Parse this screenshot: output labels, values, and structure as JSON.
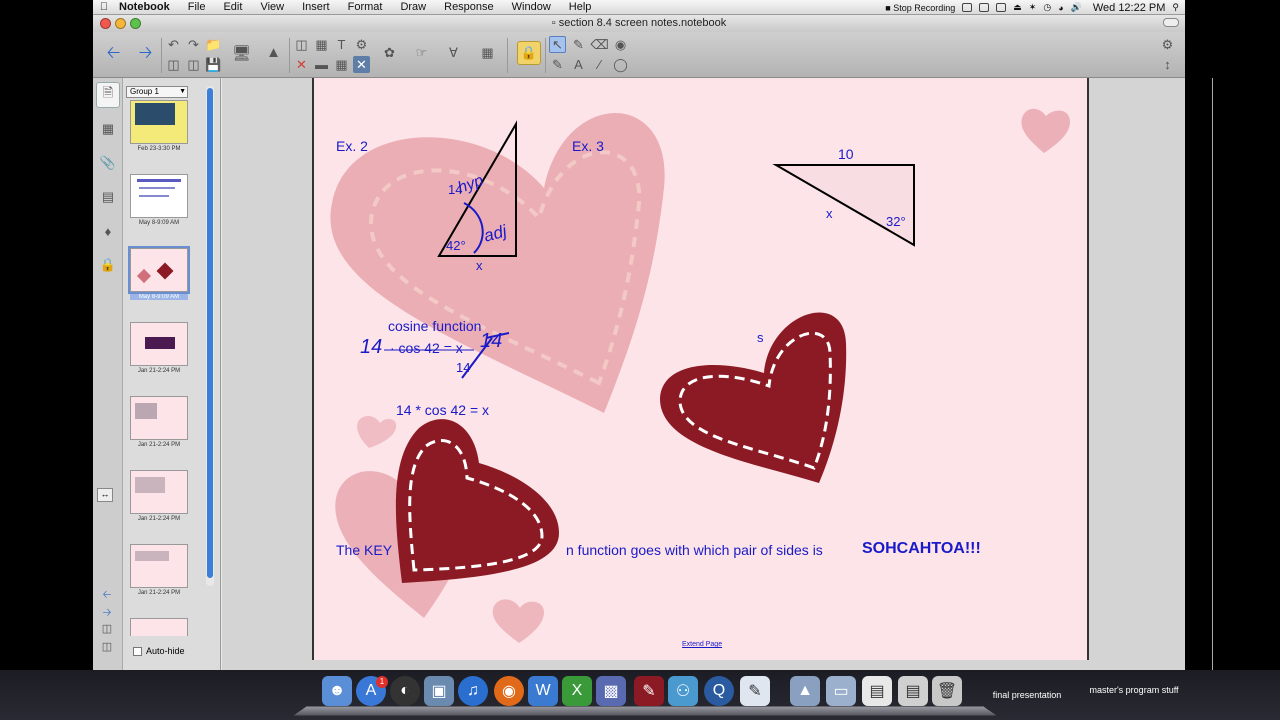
{
  "menubar": {
    "app": "Notebook",
    "items": [
      "File",
      "Edit",
      "View",
      "Insert",
      "Format",
      "Draw",
      "Response",
      "Window",
      "Help"
    ],
    "recording": "Stop Recording",
    "clock": "Wed 12:22 PM"
  },
  "window": {
    "title": "section 8.4 screen notes.notebook"
  },
  "toolbar": {
    "icons": [
      "back-arrow",
      "forward-arrow",
      "undo",
      "redo",
      "delete",
      "screen-shade",
      "table",
      "pen",
      "highlighter",
      "select",
      "eraser",
      "line",
      "shape"
    ]
  },
  "sidebar": {
    "group": "Group 1",
    "autohide": "Auto-hide",
    "thumbnails": [
      {
        "caption": "Feb 23-3:30 PM"
      },
      {
        "caption": "May 8-9:09 AM"
      },
      {
        "caption": "May 8-9:09 AM"
      },
      {
        "caption": "Jan 21-2:24 PM"
      },
      {
        "caption": "Jan 21-2:24 PM"
      },
      {
        "caption": "Jan 21-2:24 PM"
      },
      {
        "caption": "Jan 21-2:24 PM"
      }
    ]
  },
  "page": {
    "ex2": "Ex. 2",
    "ex3": "Ex. 3",
    "tri1_hyp": "14",
    "tri1_angle": "42°",
    "tri1_x": "x",
    "tri2_top": "10",
    "tri2_x": "x",
    "tri2_angle": "32°",
    "cosine": "cosine function",
    "eq1": "· cos 42 = x",
    "eq1_den": "14",
    "eq2": "14 * cos 42 = x",
    "key_prefix": "The KEY",
    "key_suffix": "n function goes with which pair of sides is",
    "sohcahtoa": "SOHCAHTOA!!!",
    "handwriting_14": "14",
    "handwriting_14b": "14",
    "handwriting_hyp": "hyp",
    "handwriting_adj": "adj",
    "fragment_s": "s",
    "extend": "Extend Page"
  },
  "dock": {
    "label1": "final presentation",
    "label2": "master's program stuff",
    "badge": "1"
  },
  "colors": {
    "ink": "#1a1ac8",
    "page": "#fce4e8",
    "heart_dark": "#8b1a24",
    "heart_light": "#e7a4ab"
  }
}
